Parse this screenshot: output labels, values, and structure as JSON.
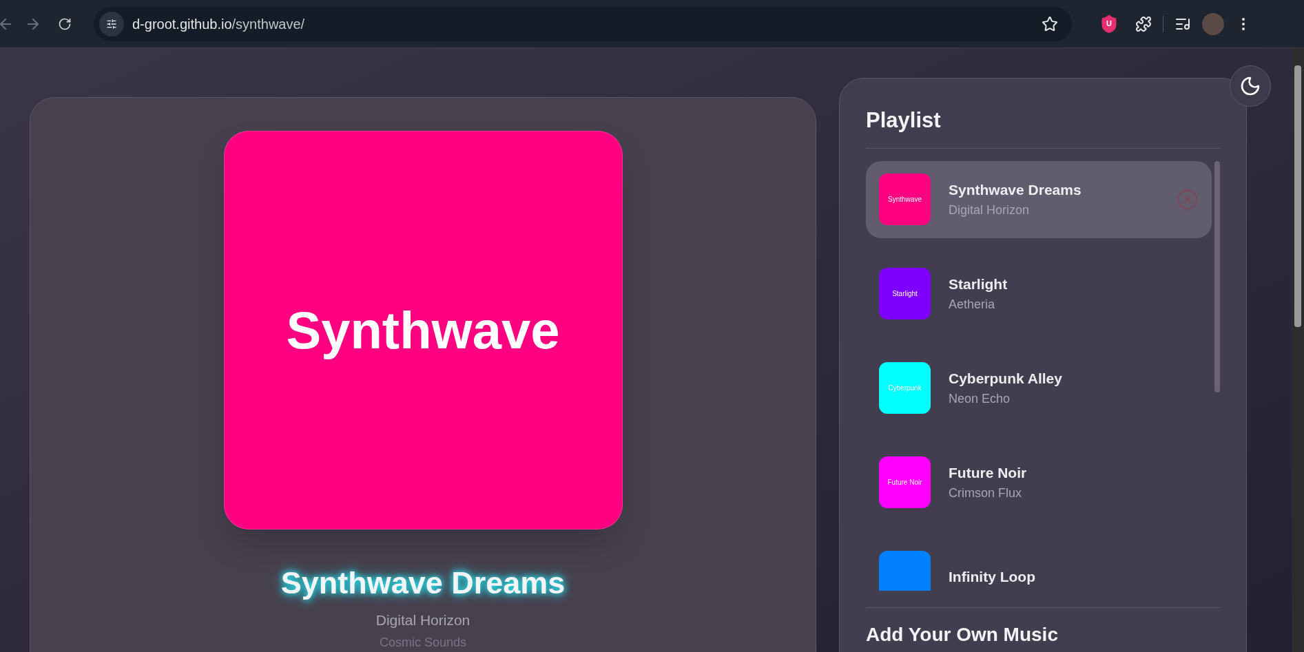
{
  "browser": {
    "url_host": "d-groot.github.io",
    "url_path": "/synthwave/",
    "extension_badge": "U"
  },
  "now_playing": {
    "cover_label": "Synthwave",
    "title": "Synthwave Dreams",
    "artist": "Digital Horizon",
    "album": "Cosmic Sounds",
    "color": "#ff0080"
  },
  "playlist": {
    "title": "Playlist",
    "tracks": [
      {
        "thumb_label": "Synthwave",
        "title": "Synthwave Dreams",
        "artist": "Digital Horizon",
        "color": "#ff0080",
        "selected": true
      },
      {
        "thumb_label": "Starlight",
        "title": "Starlight",
        "artist": "Aetheria",
        "color": "#8000ff",
        "selected": false
      },
      {
        "thumb_label": "Cyberpunk",
        "title": "Cyberpunk Alley",
        "artist": "Neon Echo",
        "color": "#00ffff",
        "selected": false
      },
      {
        "thumb_label": "Future Noir",
        "title": "Future Noir",
        "artist": "Crimson Flux",
        "color": "#ff00ff",
        "selected": false
      },
      {
        "title": "Infinity Loop",
        "color": "#0080ff",
        "selected": false
      }
    ]
  },
  "add_section": {
    "title": "Add Your Own Music"
  }
}
